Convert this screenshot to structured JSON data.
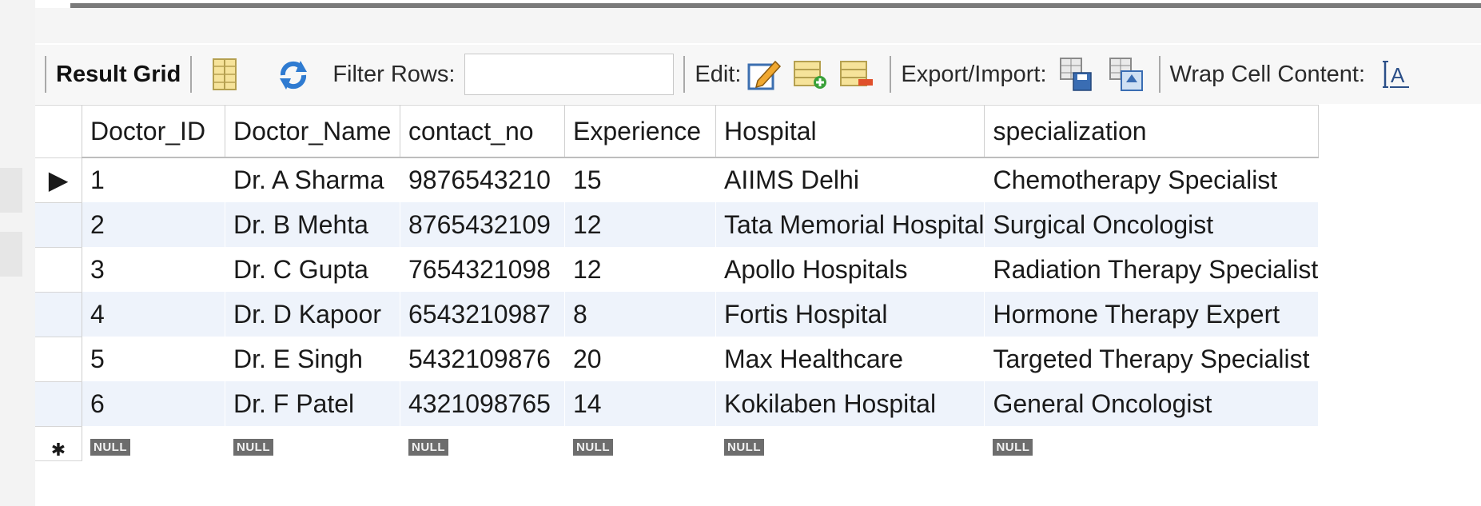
{
  "toolbar": {
    "result_grid_label": "Result Grid",
    "filter_rows_label": "Filter Rows:",
    "filter_value": "",
    "edit_label": "Edit:",
    "export_import_label": "Export/Import:",
    "wrap_cell_label": "Wrap Cell Content:"
  },
  "grid": {
    "columns": [
      "Doctor_ID",
      "Doctor_Name",
      "contact_no",
      "Experience",
      "Hospital",
      "specialization"
    ],
    "rows": [
      [
        "1",
        "Dr. A Sharma",
        "9876543210",
        "15",
        "AIIMS Delhi",
        "Chemotherapy Specialist"
      ],
      [
        "2",
        "Dr. B Mehta",
        "8765432109",
        "12",
        "Tata Memorial Hospital",
        "Surgical Oncologist"
      ],
      [
        "3",
        "Dr. C Gupta",
        "7654321098",
        "12",
        "Apollo Hospitals",
        "Radiation Therapy Specialist"
      ],
      [
        "4",
        "Dr. D Kapoor",
        "6543210987",
        "8",
        "Fortis Hospital",
        "Hormone Therapy Expert"
      ],
      [
        "5",
        "Dr. E Singh",
        "5432109876",
        "20",
        "Max Healthcare",
        "Targeted Therapy Specialist"
      ],
      [
        "6",
        "Dr. F Patel",
        "4321098765",
        "14",
        "Kokilaben Hospital",
        "General Oncologist"
      ]
    ],
    "null_label": "NULL",
    "current_row_marker": "▶",
    "new_row_marker": "✱"
  }
}
